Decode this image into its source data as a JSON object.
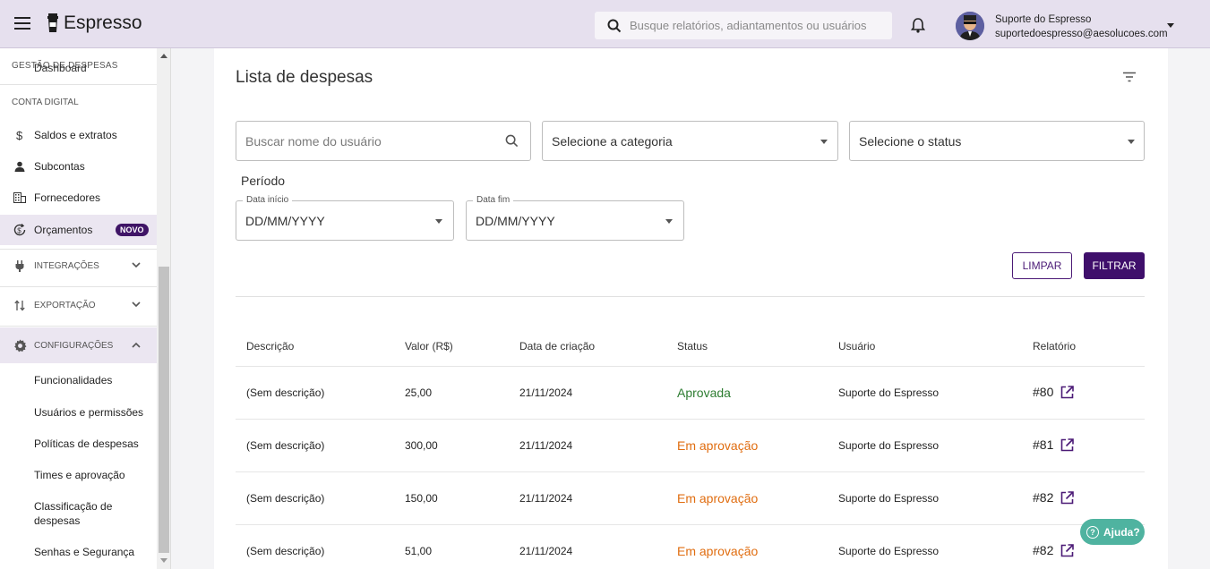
{
  "header": {
    "app_name": "Espresso",
    "search_placeholder": "Busque relatórios, adiantamentos ou usuários",
    "user_name": "Suporte do Espresso",
    "user_email": "suportedoespresso@aesolucoes.com"
  },
  "sidebar": {
    "overlap_section": "GESTÃO DE DESPESAS",
    "overlap_item": "Dashboard",
    "section_conta": "CONTA DIGITAL",
    "items": [
      {
        "label": "Saldos e extratos",
        "icon": "dollar-icon"
      },
      {
        "label": "Subcontas",
        "icon": "person-icon"
      },
      {
        "label": "Fornecedores",
        "icon": "building-icon"
      },
      {
        "label": "Orçamentos",
        "icon": "cycle-money-icon",
        "badge": "NOVO"
      }
    ],
    "groups": [
      {
        "label": "INTEGRAÇÕES",
        "icon": "plug-icon",
        "expanded": false
      },
      {
        "label": "EXPORTAÇÃO",
        "icon": "swap-vertical-icon",
        "expanded": false
      },
      {
        "label": "CONFIGURAÇÕES",
        "icon": "gear-icon",
        "expanded": true
      }
    ],
    "config_items": [
      "Funcionalidades",
      "Usuários e permissões",
      "Políticas de despesas",
      "Times e aprovação",
      "Classificação de despesas",
      "Senhas e Segurança"
    ]
  },
  "main": {
    "title": "Lista de despesas",
    "filters": {
      "user_placeholder": "Buscar nome do usuário",
      "category": "Selecione a categoria",
      "status": "Selecione o status",
      "period_label": "Período",
      "start_label": "Data início",
      "start_value": "DD/MM/YYYY",
      "end_label": "Data fim",
      "end_value": "DD/MM/YYYY"
    },
    "buttons": {
      "clear": "LIMPAR",
      "filter": "FILTRAR"
    },
    "table": {
      "columns": [
        "Descrição",
        "Valor (R$)",
        "Data de criação",
        "Status",
        "Usuário",
        "Relatório"
      ],
      "rows": [
        {
          "description": "(Sem descrição)",
          "value": "25,00",
          "date": "21/11/2024",
          "status": "Aprovada",
          "user": "Suporte do Espresso",
          "report": "#80"
        },
        {
          "description": "(Sem descrição)",
          "value": "300,00",
          "date": "21/11/2024",
          "status": "Em aprovação",
          "user": "Suporte do Espresso",
          "report": "#81"
        },
        {
          "description": "(Sem descrição)",
          "value": "150,00",
          "date": "21/11/2024",
          "status": "Em aprovação",
          "user": "Suporte do Espresso",
          "report": "#82"
        },
        {
          "description": "(Sem descrição)",
          "value": "51,00",
          "date": "21/11/2024",
          "status": "Em aprovação",
          "user": "Suporte do Espresso",
          "report": "#82"
        }
      ]
    }
  },
  "help_button": "Ajuda?",
  "colors": {
    "primary": "#3f0f6b",
    "approved": "#2e7d32",
    "pending": "#e06d10",
    "help": "#4fb3a0"
  }
}
